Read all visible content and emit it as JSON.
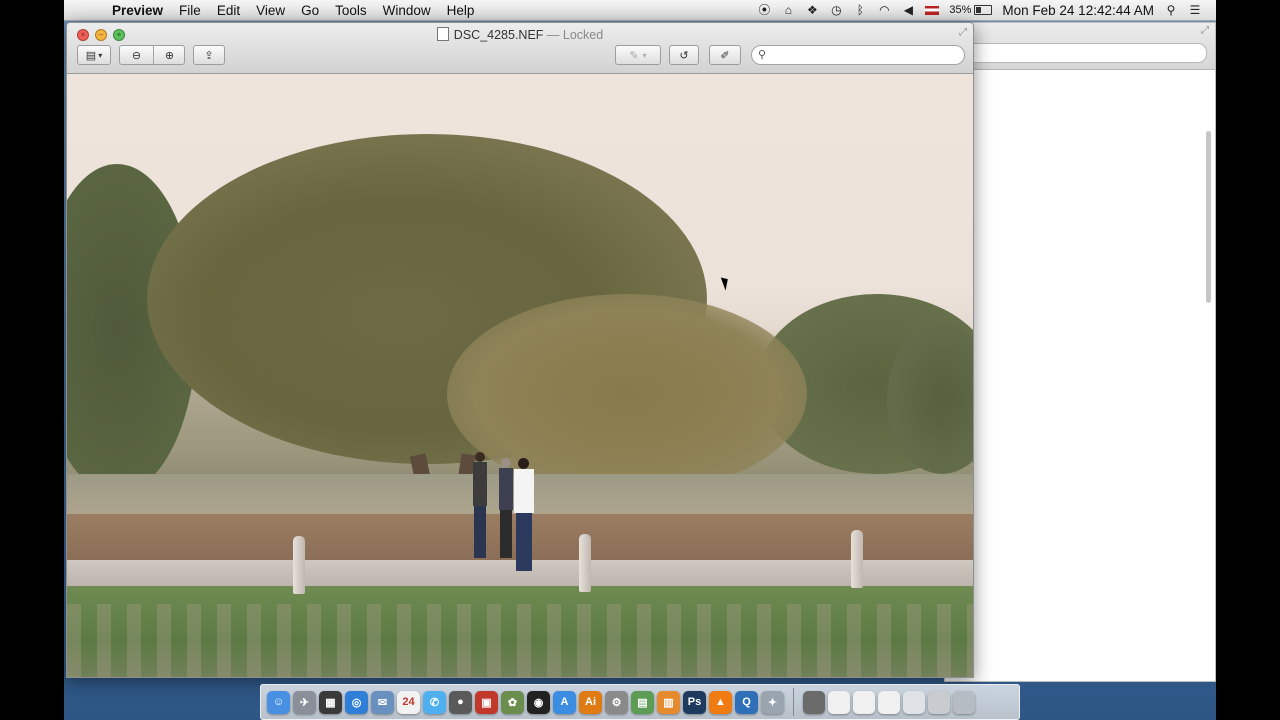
{
  "menubar": {
    "items": [
      "Preview",
      "File",
      "Edit",
      "View",
      "Go",
      "Tools",
      "Window",
      "Help"
    ],
    "status_icons": [
      "record-icon",
      "home-icon",
      "dropbox-icon",
      "time-machine-icon",
      "bluetooth-icon",
      "wifi-icon",
      "volume-icon",
      "flag-us-icon"
    ],
    "battery_percent": "35%",
    "battery_level": 0.35,
    "clock": "Mon Feb 24  12:42:44 AM",
    "right_icons": [
      "spotlight-icon",
      "notification-center-icon"
    ]
  },
  "preview_window": {
    "filename": "DSC_4285.NEF",
    "title_suffix": " — Locked",
    "toolbar": {
      "sidebar_button": "sidebar-toggle",
      "zoom_out": "zoom-out-icon",
      "zoom_in": "zoom-in-icon",
      "share": "share-icon",
      "annotate": "annotate-pen-icon",
      "rotate": "rotate-icon",
      "edit": "edit-toolbar-icon"
    },
    "search_placeholder": ""
  },
  "dock": {
    "apps": [
      {
        "name": "finder",
        "color": "#4a90e2",
        "glyph": "☺"
      },
      {
        "name": "launchpad",
        "color": "#8a8f99",
        "glyph": "✈"
      },
      {
        "name": "mission-control",
        "color": "#3a3a3a",
        "glyph": "▦"
      },
      {
        "name": "safari",
        "color": "#2f7fd8",
        "glyph": "◎"
      },
      {
        "name": "mail",
        "color": "#6a90c0",
        "glyph": "✉"
      },
      {
        "name": "calendar",
        "color": "#f2f2f2",
        "glyph": "24"
      },
      {
        "name": "messages",
        "color": "#4fb0f0",
        "glyph": "✆"
      },
      {
        "name": "facetime",
        "color": "#5a5a5a",
        "glyph": "●"
      },
      {
        "name": "photo-booth",
        "color": "#c0392b",
        "glyph": "▣"
      },
      {
        "name": "iphoto",
        "color": "#6b8e4e",
        "glyph": "✿"
      },
      {
        "name": "dvd-player",
        "color": "#222",
        "glyph": "◉"
      },
      {
        "name": "app-store",
        "color": "#3a8de0",
        "glyph": "A"
      },
      {
        "name": "illustrator",
        "color": "#e07a12",
        "glyph": "Ai"
      },
      {
        "name": "system-preferences",
        "color": "#8a8a8a",
        "glyph": "⚙"
      },
      {
        "name": "preview",
        "color": "#5d9c54",
        "glyph": "▤"
      },
      {
        "name": "ibooks",
        "color": "#e68a2e",
        "glyph": "▥"
      },
      {
        "name": "photoshop",
        "color": "#1f3a5f",
        "glyph": "Ps"
      },
      {
        "name": "vlc",
        "color": "#f07b12",
        "glyph": "▲"
      },
      {
        "name": "quicktime",
        "color": "#2e6fb7",
        "glyph": "Q"
      },
      {
        "name": "utility",
        "color": "#9aa4ae",
        "glyph": "✦"
      }
    ],
    "stacks": [
      {
        "name": "downloads-stack",
        "color": "#6b6b6b"
      },
      {
        "name": "document-stack-1",
        "color": "#f0f0f0"
      },
      {
        "name": "document-stack-2",
        "color": "#f0f0f0"
      },
      {
        "name": "document-stack-3",
        "color": "#f0f0f0"
      },
      {
        "name": "document-stack-4",
        "color": "#dfe3e8"
      },
      {
        "name": "document-stack-5",
        "color": "#c8ccd0"
      },
      {
        "name": "trash",
        "color": "#b5bcc3"
      }
    ]
  }
}
